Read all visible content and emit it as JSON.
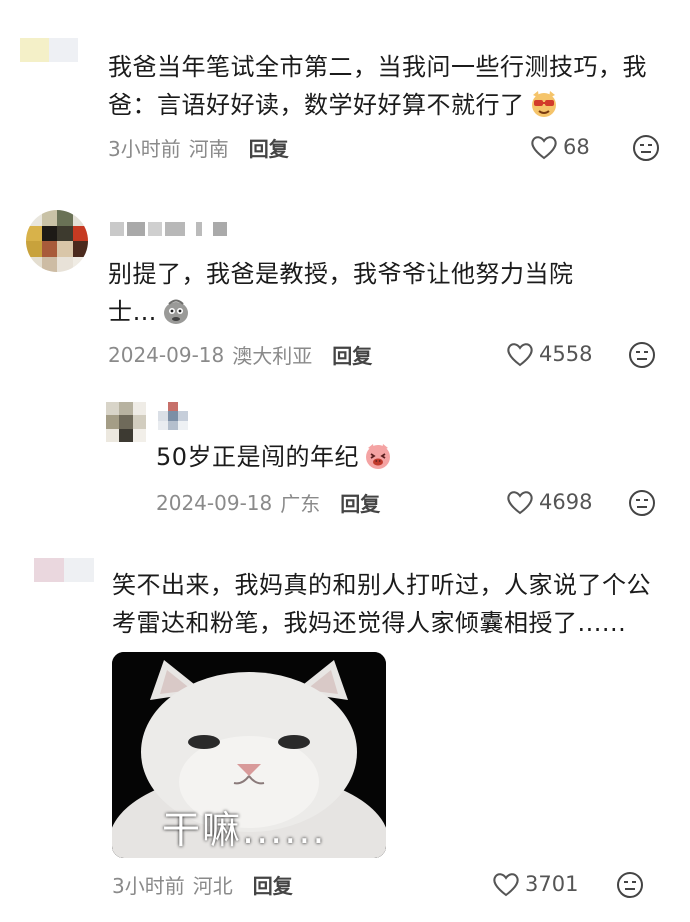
{
  "comments": [
    {
      "text_line1": "我爸当年笔试全市第二，当我问一些行测技巧，我",
      "text_line2": "爸：言语好好读，数学好好算不就行了",
      "emoji": "dog-glasses-emoji",
      "time": "3小时前",
      "location": "河南",
      "reply_label": "回复",
      "likes": "68"
    },
    {
      "text_line1": "别提了，我爸是教授，我爷爷让他努力当院",
      "text_line2": "士…",
      "emoji": "sweat-face-emoji",
      "time": "2024-09-18",
      "location": "澳大利亚",
      "reply_label": "回复",
      "likes": "4558"
    },
    {
      "text_line1": "50岁正是闯的年纪",
      "emoji": "laughing-pig-emoji",
      "time": "2024-09-18",
      "location": "广东",
      "reply_label": "回复",
      "likes": "4698"
    },
    {
      "text_line1": "笑不出来，我妈真的和别人打听过，人家说了个公",
      "text_line2": "考雷达和粉笔，我妈还觉得人家倾囊相授了......",
      "meme_caption": "干嘛......",
      "time": "3小时前",
      "location": "河北",
      "reply_label": "回复",
      "likes": "3701"
    }
  ],
  "colors": {
    "meta_gray": "#8a8a8a",
    "text": "#1b1b1b",
    "icon_gray": "#555555"
  }
}
